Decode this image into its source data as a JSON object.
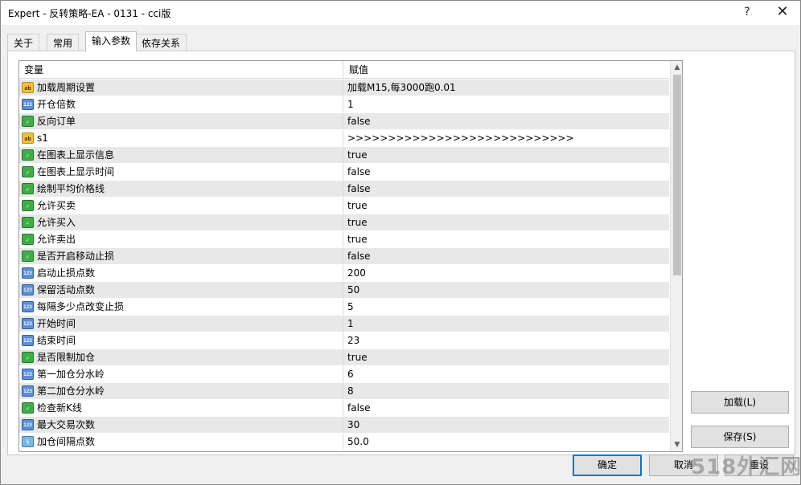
{
  "window": {
    "title": "Expert - 反转策略-EA - 0131 - cci版",
    "help_glyph": "?",
    "close_glyph": "✕"
  },
  "tabs": [
    {
      "label": "关于"
    },
    {
      "label": "常用"
    },
    {
      "label": "输入参数",
      "active": true
    },
    {
      "label": "依存关系"
    }
  ],
  "grid": {
    "headers": {
      "variable": "变量",
      "value": "赋值"
    },
    "rows": [
      {
        "icon": "string-icon",
        "icon_text": "ab",
        "name": "加载周期设置",
        "value": "加载M15,每3000跑0.01"
      },
      {
        "icon": "integer-icon",
        "icon_text": "123",
        "name": "开仓倍数",
        "value": "1"
      },
      {
        "icon": "bool-icon",
        "icon_text": "✓",
        "name": "反向订单",
        "value": "false"
      },
      {
        "icon": "string-icon",
        "icon_text": "ab",
        "name": "s1",
        "value": ">>>>>>>>>>>>>>>>>>>>>>>>>>>>"
      },
      {
        "icon": "bool-icon",
        "icon_text": "✓",
        "name": "在图表上显示信息",
        "value": "true"
      },
      {
        "icon": "bool-icon",
        "icon_text": "✓",
        "name": "在图表上显示时间",
        "value": "false"
      },
      {
        "icon": "bool-icon",
        "icon_text": "✓",
        "name": "绘制平均价格线",
        "value": "false"
      },
      {
        "icon": "bool-icon",
        "icon_text": "✓",
        "name": "允许买卖",
        "value": "true"
      },
      {
        "icon": "bool-icon",
        "icon_text": "✓",
        "name": "允许买入",
        "value": "true"
      },
      {
        "icon": "bool-icon",
        "icon_text": "✓",
        "name": "允许卖出",
        "value": "true"
      },
      {
        "icon": "bool-icon",
        "icon_text": "✓",
        "name": "是否开启移动止损",
        "value": "false"
      },
      {
        "icon": "integer-icon",
        "icon_text": "123",
        "name": "启动止损点数",
        "value": "200"
      },
      {
        "icon": "integer-icon",
        "icon_text": "123",
        "name": "保留活动点数",
        "value": "50"
      },
      {
        "icon": "integer-icon",
        "icon_text": "123",
        "name": "每隔多少点改变止损",
        "value": "5"
      },
      {
        "icon": "integer-icon",
        "icon_text": "123",
        "name": "开始时间",
        "value": "1"
      },
      {
        "icon": "integer-icon",
        "icon_text": "123",
        "name": "结束时间",
        "value": "23"
      },
      {
        "icon": "bool-icon",
        "icon_text": "✓",
        "name": "是否限制加仓",
        "value": "true"
      },
      {
        "icon": "integer-icon",
        "icon_text": "123",
        "name": "第一加仓分水岭",
        "value": "6"
      },
      {
        "icon": "integer-icon",
        "icon_text": "123",
        "name": "第二加仓分水岭",
        "value": "8"
      },
      {
        "icon": "bool-icon",
        "icon_text": "✓",
        "name": "检查新K线",
        "value": "false"
      },
      {
        "icon": "integer-icon",
        "icon_text": "123",
        "name": "最大交易次数",
        "value": "30"
      },
      {
        "icon": "double-icon",
        "icon_text": "½",
        "name": "加仓间隔点数",
        "value": "50.0"
      }
    ]
  },
  "scrollbar": {
    "up_glyph": "▲",
    "down_glyph": "▼"
  },
  "buttons": {
    "load": "加载(L)",
    "save": "保存(S)",
    "ok": "确定",
    "cancel": "取消",
    "reset": "重设"
  },
  "watermark": "518外汇网"
}
